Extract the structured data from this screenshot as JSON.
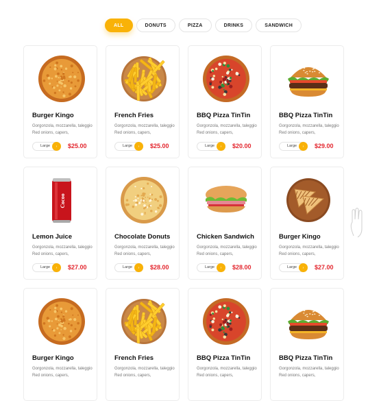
{
  "tabs": [
    "ALL",
    "DONUTS",
    "PIZZA",
    "DRINKS",
    "SANDWICH"
  ],
  "products": [
    {
      "name": "Burger Kingo",
      "desc": "Gorgonzola, mozzarella, taleggio Red onions, capers,",
      "size": "Large",
      "price": "$25.00",
      "image": "cheese-pizza"
    },
    {
      "name": "French Fries",
      "desc": "Gorgonzola, mozzarella, taleggio Red onions, capers,",
      "size": "Large",
      "price": "$25.00",
      "image": "french-fries"
    },
    {
      "name": "BBQ Pizza TinTin",
      "desc": "Gorgonzola, mozzarella, taleggio Red onions, capers,",
      "size": "Large",
      "price": "$20.00",
      "image": "veggie-pizza"
    },
    {
      "name": "BBQ Pizza TinTin",
      "desc": "Gorgonzola, mozzarella, taleggio Red onions, capers,",
      "size": "Large",
      "price": "$29.00",
      "image": "burger"
    },
    {
      "name": "Lemon Juice",
      "desc": "Gorgonzola, mozzarella, taleggio Red onions, capers,",
      "size": "Large",
      "price": "$27.00",
      "image": "soda-can",
      "can_text": "Cocoo"
    },
    {
      "name": "Chocolate Donuts",
      "desc": "Gorgonzola, mozzarella, taleggio Red onions, capers,",
      "size": "Large",
      "price": "$28.00",
      "image": "cheese-pizza-light"
    },
    {
      "name": "Chicken Sandwich",
      "desc": "Gorgonzola, mozzarella, taleggio Red onions, capers,",
      "size": "Large",
      "price": "$28.00",
      "image": "sandwich"
    },
    {
      "name": "Burger Kingo",
      "desc": "Gorgonzola, mozzarella, taleggio Red onions, capers,",
      "size": "Large",
      "price": "$27.00",
      "image": "grilled-sandwich"
    },
    {
      "name": "Burger Kingo",
      "desc": "Gorgonzola, mozzarella, taleggio Red onions, capers,",
      "image": "cheese-pizza"
    },
    {
      "name": "French Fries",
      "desc": "Gorgonzola, mozzarella, taleggio Red onions, capers,",
      "image": "french-fries"
    },
    {
      "name": "BBQ Pizza TinTin",
      "desc": "Gorgonzola, mozzarella, taleggio Red onions, capers,",
      "image": "veggie-pizza"
    },
    {
      "name": "BBQ Pizza TinTin",
      "desc": "Gorgonzola, mozzarella, taleggio Red onions, capers,",
      "image": "burger"
    }
  ],
  "colors": {
    "accent": "#f9b208",
    "price": "#e3262e",
    "text": "#111111",
    "muted": "#777777"
  }
}
